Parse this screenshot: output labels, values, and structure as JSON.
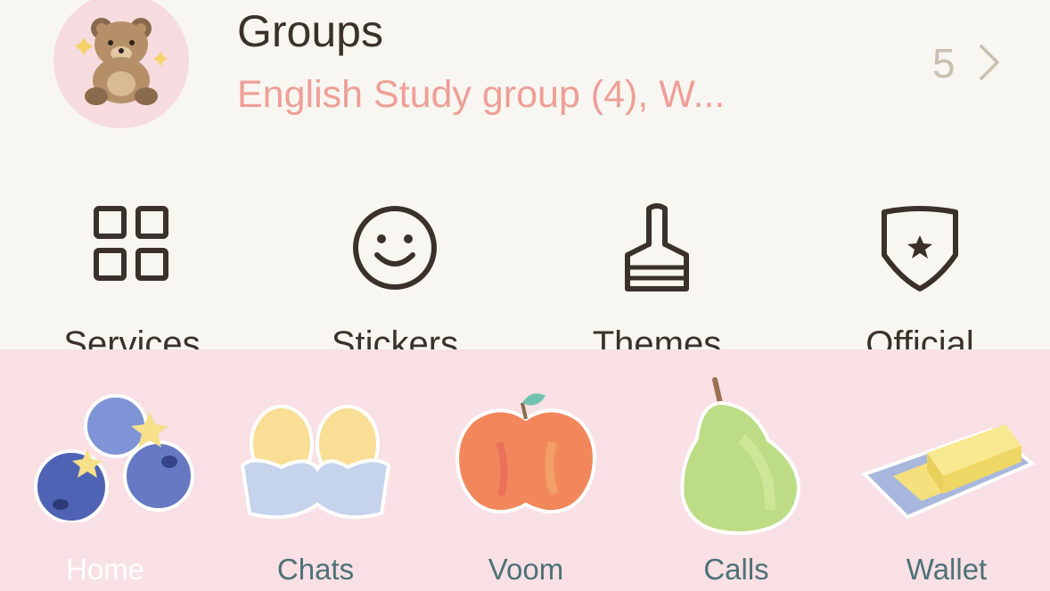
{
  "groups": {
    "title": "Groups",
    "subtitle": "English Study group (4), W...",
    "count": "5"
  },
  "shortcuts": [
    {
      "label": "Services",
      "icon": "grid-icon"
    },
    {
      "label": "Stickers",
      "icon": "smiley-icon"
    },
    {
      "label": "Themes",
      "icon": "brush-icon"
    },
    {
      "label": "Official",
      "icon": "shield-star-icon"
    }
  ],
  "tabs": [
    {
      "label": "Home",
      "icon": "blueberries-icon",
      "active": true
    },
    {
      "label": "Chats",
      "icon": "eggs-icon"
    },
    {
      "label": "Voom",
      "icon": "apple-icon"
    },
    {
      "label": "Calls",
      "icon": "pear-icon"
    },
    {
      "label": "Wallet",
      "icon": "butter-icon"
    }
  ],
  "colors": {
    "text_dark": "#3b312c",
    "subtitle_pink": "#ee9f97",
    "tabbar_bg": "#f8e0e5",
    "tab_label": "#4d7176"
  }
}
